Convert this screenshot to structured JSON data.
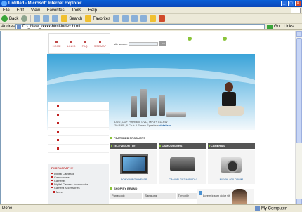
{
  "window": {
    "title": "Untitled - Microsoft Internet Explorer",
    "min": "_",
    "max": "□",
    "close": "×"
  },
  "menu": [
    "File",
    "Edit",
    "View",
    "Favorites",
    "Tools",
    "Help"
  ],
  "toolbar": {
    "back": "Back",
    "search": "Search",
    "favorites": "Favorites"
  },
  "address": {
    "label": "Address",
    "value": "D:\\_New_\\xxxx\\html\\index.html",
    "go": "Go",
    "links": "Links"
  },
  "page": {
    "nav": [
      "HOME",
      "LINKS",
      "FAQ",
      "SITEMAP"
    ],
    "search_label": "site search",
    "search_go": "GO",
    "banner_text": "DVD, CD+ Playback: DVD, MP3 + CD-RW",
    "banner_text2": "20 RMS, 8-Ch + 5 Stereo Speakers",
    "banner_details": "details »",
    "photography": {
      "heading": "PHOTOGRAPHY",
      "items": [
        "Digital Cameras",
        "Camcorders",
        "Cameras",
        "Digital Camera Accessories",
        "Camera Accessories"
      ],
      "more": "More"
    },
    "featured_heading": "FEATURED PRODUCTS",
    "categories": [
      "TELEVISION (TV)",
      "CAMCORDERS",
      "CAMERAS"
    ],
    "products": [
      "SONY WEGA KE61B",
      "CANON GL2 MINI DV",
      "NIKON 800 D5MM"
    ],
    "shop_heading": "SHOP BY BRAND",
    "brands": [
      "Panasonic",
      "Samsung",
      "T-mobile"
    ],
    "lorem": "Lorem ipsum dolor sit"
  },
  "status": {
    "done": "Done",
    "zone": "My Computer"
  }
}
